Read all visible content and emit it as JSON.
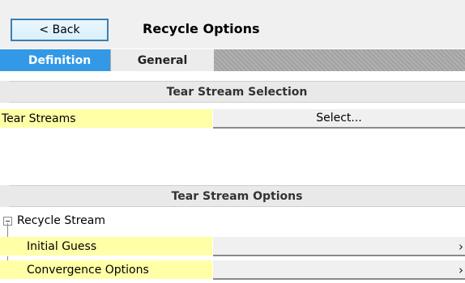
{
  "header": {
    "back_label": "< Back",
    "title": "Recycle Options"
  },
  "tabs": [
    {
      "label": "Definition",
      "active": true
    },
    {
      "label": "General",
      "active": false
    }
  ],
  "sections": {
    "tear_selection": {
      "title": "Tear Stream Selection",
      "row_label": "Tear Streams",
      "row_value": "Select..."
    },
    "tear_options": {
      "title": "Tear Stream Options",
      "group_label": "Recycle Stream",
      "items": [
        {
          "label": "Initial Guess",
          "value": ""
        },
        {
          "label": "Convergence Options",
          "value": ""
        }
      ],
      "chevron": "›"
    }
  },
  "colors": {
    "accent_tab": "#3399e6",
    "label_bg": "#ffffa8",
    "back_border": "#3c7fb1"
  }
}
